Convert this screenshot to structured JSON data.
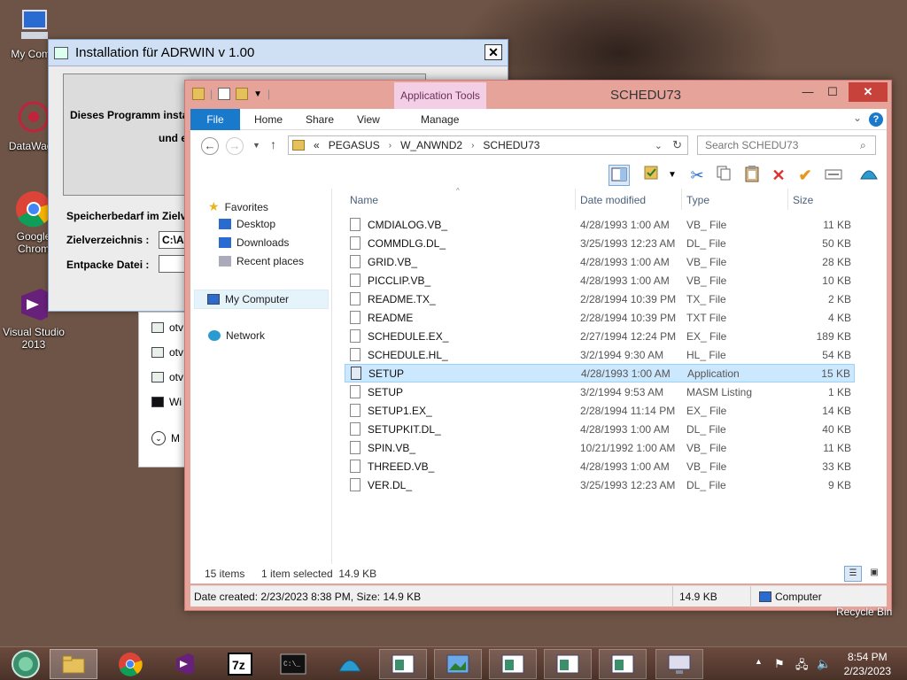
{
  "desktop": {
    "icons": [
      {
        "label": "My Comp"
      },
      {
        "label": "DataWage"
      },
      {
        "label": "Google Chrom"
      },
      {
        "label": "Visual Studio 2013"
      }
    ],
    "recycle_bin_label": "Recycle Bin"
  },
  "installer": {
    "title": "Installation für ADRWIN v 1.00",
    "close": "✕",
    "description_line1": "Dieses Programm instal",
    "description_line2": "und e",
    "storage_label": "Speicherbedarf im Zielv",
    "target_dir_label": "Zielverzeichnis :",
    "target_dir_value": "C:\\A",
    "unpack_label": "Entpacke Datei :",
    "unpack_value": ""
  },
  "bg_explorer": {
    "rows": [
      {
        "label": "otv"
      },
      {
        "label": "otv"
      },
      {
        "label": "otv"
      },
      {
        "label": "Wi"
      },
      {
        "label": "M"
      }
    ]
  },
  "explorer": {
    "title": "SCHEDU73",
    "app_tools": "Application Tools",
    "tabs": {
      "file": "File",
      "home": "Home",
      "share": "Share",
      "view": "View",
      "manage": "Manage"
    },
    "help": "?",
    "address": {
      "overflow": "«",
      "crumbs": [
        "PEGASUS",
        "W_ANWND2",
        "SCHEDU73"
      ]
    },
    "search_placeholder": "Search SCHEDU73",
    "nav": {
      "favorites": "Favorites",
      "desktop": "Desktop",
      "downloads": "Downloads",
      "recent": "Recent places",
      "my_computer": "My Computer",
      "network": "Network"
    },
    "columns": {
      "name": "Name",
      "date": "Date modified",
      "type": "Type",
      "size": "Size"
    },
    "files": [
      {
        "name": "CMDIALOG.VB_",
        "date": "4/28/1993 1:00 AM",
        "type": "VB_ File",
        "size": "11 KB"
      },
      {
        "name": "COMMDLG.DL_",
        "date": "3/25/1993 12:23 AM",
        "type": "DL_ File",
        "size": "50 KB"
      },
      {
        "name": "GRID.VB_",
        "date": "4/28/1993 1:00 AM",
        "type": "VB_ File",
        "size": "28 KB"
      },
      {
        "name": "PICCLIP.VB_",
        "date": "4/28/1993 1:00 AM",
        "type": "VB_ File",
        "size": "10 KB"
      },
      {
        "name": "README.TX_",
        "date": "2/28/1994 10:39 PM",
        "type": "TX_ File",
        "size": "2 KB"
      },
      {
        "name": "README",
        "date": "2/28/1994 10:39 PM",
        "type": "TXT File",
        "size": "4 KB"
      },
      {
        "name": "SCHEDULE.EX_",
        "date": "2/27/1994 12:24 PM",
        "type": "EX_ File",
        "size": "189 KB"
      },
      {
        "name": "SCHEDULE.HL_",
        "date": "3/2/1994 9:30 AM",
        "type": "HL_ File",
        "size": "54 KB"
      },
      {
        "name": "SETUP",
        "date": "4/28/1993 1:00 AM",
        "type": "Application",
        "size": "15 KB"
      },
      {
        "name": "SETUP",
        "date": "3/2/1994 9:53 AM",
        "type": "MASM Listing",
        "size": "1 KB"
      },
      {
        "name": "SETUP1.EX_",
        "date": "2/28/1994 11:14 PM",
        "type": "EX_ File",
        "size": "14 KB"
      },
      {
        "name": "SETUPKIT.DL_",
        "date": "4/28/1993 1:00 AM",
        "type": "DL_ File",
        "size": "40 KB"
      },
      {
        "name": "SPIN.VB_",
        "date": "10/21/1992 1:00 AM",
        "type": "VB_ File",
        "size": "11 KB"
      },
      {
        "name": "THREED.VB_",
        "date": "4/28/1993 1:00 AM",
        "type": "VB_ File",
        "size": "33 KB"
      },
      {
        "name": "VER.DL_",
        "date": "3/25/1993 12:23 AM",
        "type": "DL_ File",
        "size": "9 KB"
      }
    ],
    "status": {
      "count": "15 items",
      "selected": "1 item selected  14.9 KB"
    },
    "details_bar": {
      "info": "Date created: 2/23/2023 8:38 PM, Size: 14.9 KB",
      "size": "14.9 KB",
      "location": "Computer"
    }
  },
  "taskbar": {
    "items": [
      "start-button",
      "file-explorer",
      "chrome",
      "visual-studio",
      "7zip",
      "command-prompt",
      "app-shell",
      "window-1",
      "window-2",
      "window-3",
      "window-4",
      "window-5",
      "window-6"
    ],
    "clock_time": "8:54 PM",
    "clock_date": "2/23/2023"
  }
}
